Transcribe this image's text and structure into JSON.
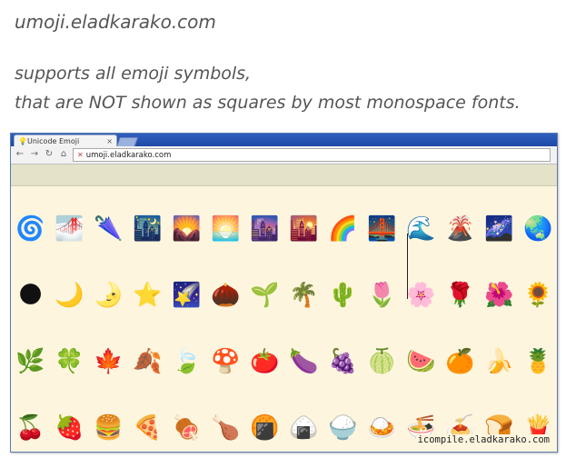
{
  "captions": {
    "site": "umoji.eladkarako.com",
    "line1": "supports all emoji symbols,",
    "line2": "that are NOT shown as squares by most monospace fonts."
  },
  "browser": {
    "tab_title": "Unicode Emoji",
    "tab_close": "×",
    "url": "umoji.eladkarako.com",
    "nav": {
      "back": "←",
      "forward": "→",
      "reload": "↻",
      "home": "⌂"
    },
    "favicon": "💡"
  },
  "emoji_rows": [
    [
      "🌀",
      "🌁",
      "🌂",
      "🌃",
      "🌄",
      "🌅",
      "🌆",
      "🌇",
      "🌈",
      "🌉",
      "🌊",
      "🌋",
      "🌌",
      "🌏"
    ],
    [
      "🌑",
      "🌙",
      "🌛",
      "⭐",
      "🌠",
      "🌰",
      "🌱",
      "🌴",
      "🌵",
      "🌷",
      "🌸",
      "🌹",
      "🌺",
      "🌻"
    ],
    [
      "🌿",
      "🍀",
      "🍁",
      "🍂",
      "🍃",
      "🍄",
      "🍅",
      "🍆",
      "🍇",
      "🍈",
      "🍉",
      "🍊",
      "🍌",
      "🍍"
    ],
    [
      "🍒",
      "🍓",
      "🍔",
      "🍕",
      "🍖",
      "🍗",
      "🍘",
      "🍙",
      "🍚",
      "🍛",
      "🍜",
      "🍝",
      "🍞",
      "🍟"
    ]
  ],
  "credit": "icompile.eladkarako.com",
  "colors": {
    "titlebar": "#2f5fbf",
    "content_bg": "#fdf5de",
    "bookmarks_bg": "#e4e2c8"
  }
}
